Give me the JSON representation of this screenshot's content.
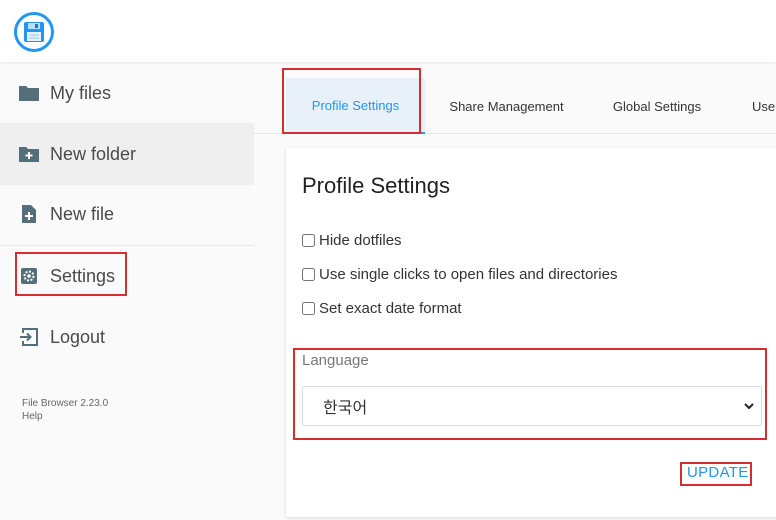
{
  "header": {
    "logo_icon": "floppy-disk-icon",
    "accent_color": "#2196f3"
  },
  "sidebar": {
    "items": [
      {
        "label": "My files",
        "icon": "folder-icon"
      },
      {
        "label": "New folder",
        "icon": "folder-plus-icon"
      },
      {
        "label": "New file",
        "icon": "file-plus-icon"
      },
      {
        "label": "Settings",
        "icon": "gear-icon"
      },
      {
        "label": "Logout",
        "icon": "logout-icon"
      }
    ],
    "version": "File Browser 2.23.0",
    "help": "Help"
  },
  "tabs": [
    {
      "label": "Profile Settings",
      "active": true
    },
    {
      "label": "Share Management",
      "active": false
    },
    {
      "label": "Global Settings",
      "active": false
    },
    {
      "label": "User Management",
      "active": false
    }
  ],
  "profile": {
    "title": "Profile Settings",
    "options": [
      {
        "label": "Hide dotfiles",
        "checked": false
      },
      {
        "label": "Use single clicks to open files and directories",
        "checked": false
      },
      {
        "label": "Set exact date format",
        "checked": false
      }
    ],
    "language_label": "Language",
    "language_value": "한국어",
    "update_label": "UPDATE"
  },
  "colors": {
    "highlight": "#d32f2f",
    "accent": "#2196f3"
  }
}
